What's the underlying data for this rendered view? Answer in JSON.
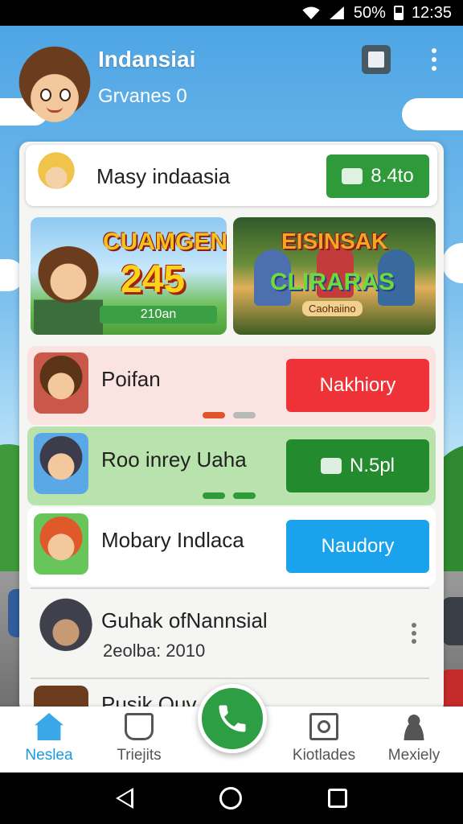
{
  "status_bar": {
    "battery": "50%",
    "time": "12:35"
  },
  "header": {
    "title": "Indansiai",
    "subtitle": "Grvanes 0"
  },
  "top_row": {
    "title": "Masy indaasia",
    "button_label": "8.4to"
  },
  "banners": [
    {
      "title": "CUAMGEN",
      "number": "245",
      "pill": "210an"
    },
    {
      "title": "EISINSAK",
      "subtitle": "CLIRARAS",
      "caption": "Caohaiino"
    }
  ],
  "list": [
    {
      "title": "Poifan",
      "button_label": "Nakhiory",
      "color": "#ee3237"
    },
    {
      "title": "Roo inrey Uaha",
      "button_label": "N.5pl",
      "color": "#238a2e"
    },
    {
      "title": "Mobary Indlaca",
      "button_label": "Naudory",
      "color": "#1aa3ec"
    },
    {
      "title": "Guhak ofNannsial",
      "subtitle": "2eolba:  2010"
    },
    {
      "title": "Pusik Quv"
    }
  ],
  "bottom_nav": [
    {
      "label": "Neslea",
      "icon": "home-icon",
      "active": true
    },
    {
      "label": "Triejits",
      "icon": "cup-icon"
    },
    {
      "label": "Kiotlades",
      "icon": "box-icon"
    },
    {
      "label": "Mexiely",
      "icon": "person-icon"
    }
  ],
  "fab": {
    "icon": "phone-icon"
  }
}
